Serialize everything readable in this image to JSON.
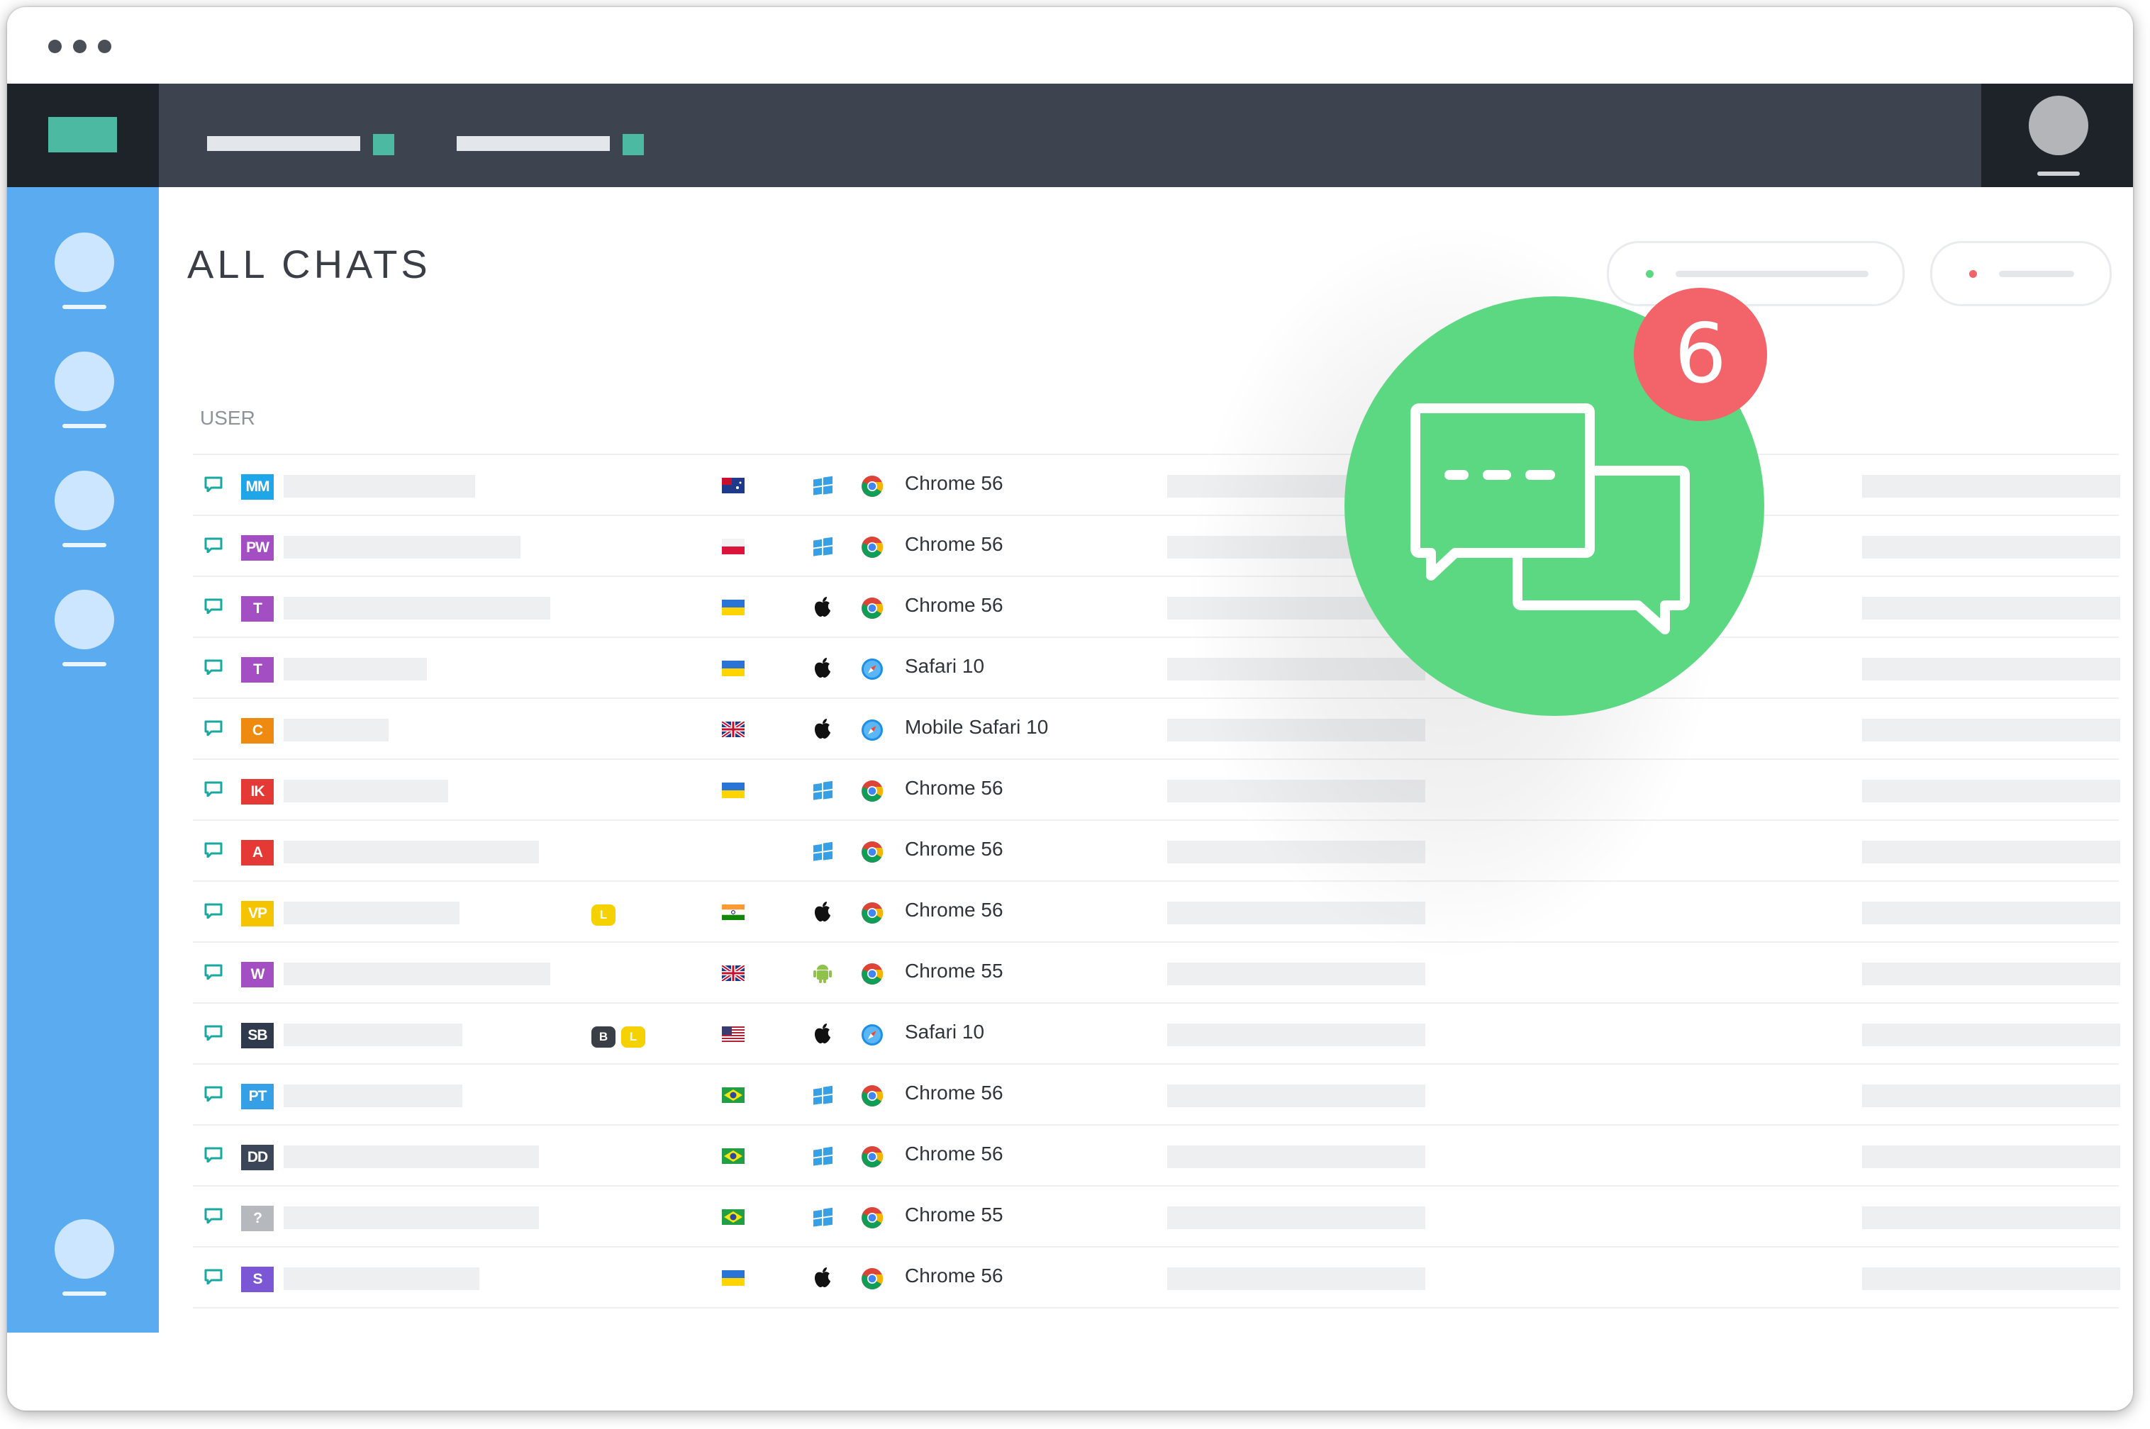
{
  "window": {
    "title_dots": [
      "dot",
      "dot",
      "dot"
    ]
  },
  "header": {
    "nav_items": [
      {
        "name": "nav-item-1"
      },
      {
        "name": "nav-item-2"
      }
    ]
  },
  "page": {
    "title": "ALL CHATS",
    "column_user": "USER"
  },
  "notification": {
    "count": "6",
    "icon": "chat-bubbles-icon",
    "color": "#5dd882",
    "badge_color": "#f2646a"
  },
  "chats": [
    {
      "initials": "MM",
      "color": "#1fa6e8",
      "tags": [],
      "flag": "australia",
      "os": "windows-icon",
      "browser": "chrome-icon",
      "browser_label": "Chrome 56"
    },
    {
      "initials": "PW",
      "color": "#a34ec2",
      "tags": [],
      "flag": "poland",
      "os": "windows-icon",
      "browser": "chrome-icon",
      "browser_label": "Chrome 56"
    },
    {
      "initials": "T",
      "color": "#a34ec2",
      "tags": [],
      "flag": "ukraine",
      "os": "apple-icon",
      "browser": "chrome-icon",
      "browser_label": "Chrome 56"
    },
    {
      "initials": "T",
      "color": "#a34ec2",
      "tags": [],
      "flag": "ukraine",
      "os": "apple-icon",
      "browser": "safari-icon",
      "browser_label": "Safari 10"
    },
    {
      "initials": "C",
      "color": "#ef8a10",
      "tags": [],
      "flag": "uk",
      "os": "apple-icon",
      "browser": "safari-icon",
      "browser_label": "Mobile Safari 10"
    },
    {
      "initials": "IK",
      "color": "#e53935",
      "tags": [],
      "flag": "ukraine",
      "os": "windows-icon",
      "browser": "chrome-icon",
      "browser_label": "Chrome 56"
    },
    {
      "initials": "A",
      "color": "#e53935",
      "tags": [],
      "flag": "none",
      "os": "windows-icon",
      "browser": "chrome-icon",
      "browser_label": "Chrome 56"
    },
    {
      "initials": "VP",
      "color": "#f5c400",
      "tags": [
        {
          "label": "L",
          "color": "#f5d100"
        }
      ],
      "flag": "india",
      "os": "apple-icon",
      "browser": "chrome-icon",
      "browser_label": "Chrome 56"
    },
    {
      "initials": "W",
      "color": "#a34ec2",
      "tags": [],
      "flag": "uk",
      "os": "android-icon",
      "browser": "chrome-icon",
      "browser_label": "Chrome 55"
    },
    {
      "initials": "SB",
      "color": "#2f3b4c",
      "tags": [
        {
          "label": "B",
          "color": "#3a3f47"
        },
        {
          "label": "L",
          "color": "#f5d100"
        }
      ],
      "flag": "usa",
      "os": "apple-icon",
      "browser": "safari-icon",
      "browser_label": "Safari 10"
    },
    {
      "initials": "PT",
      "color": "#35a0e6",
      "tags": [],
      "flag": "brazil",
      "os": "windows-icon",
      "browser": "chrome-icon",
      "browser_label": "Chrome 56"
    },
    {
      "initials": "DD",
      "color": "#3b4758",
      "tags": [],
      "flag": "brazil",
      "os": "windows-icon",
      "browser": "chrome-icon",
      "browser_label": "Chrome 56"
    },
    {
      "initials": "?",
      "color": "#b5b8bc",
      "tags": [],
      "flag": "brazil",
      "os": "windows-icon",
      "browser": "chrome-icon",
      "browser_label": "Chrome 55"
    },
    {
      "initials": "S",
      "color": "#7b57d6",
      "tags": [],
      "flag": "ukraine",
      "os": "apple-icon",
      "browser": "chrome-icon",
      "browser_label": "Chrome 56"
    }
  ]
}
